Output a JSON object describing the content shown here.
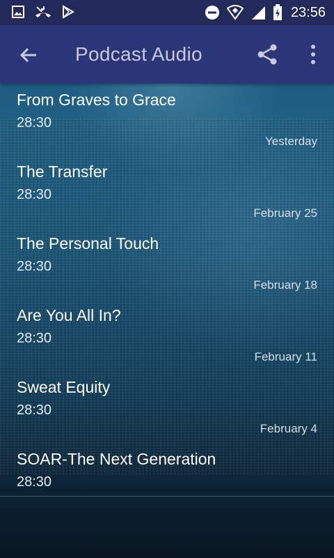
{
  "status_bar": {
    "time": "23:56",
    "left_icons": [
      "image-icon",
      "missed-call-icon",
      "play-store-icon"
    ],
    "right_icons": [
      "do-not-disturb-icon",
      "wifi-icon",
      "signal-icon",
      "battery-charging-icon"
    ]
  },
  "app_bar": {
    "title": "Podcast Audio",
    "back_icon": "arrow-back-icon",
    "share_icon": "share-icon",
    "more_icon": "more-vert-icon"
  },
  "episodes": [
    {
      "title": "From Graves to Grace",
      "duration": "28:30",
      "date": "Yesterday"
    },
    {
      "title": "The Transfer",
      "duration": "28:30",
      "date": "February 25"
    },
    {
      "title": "The Personal Touch",
      "duration": "28:30",
      "date": "February 18"
    },
    {
      "title": "Are You All In?",
      "duration": "28:30",
      "date": "February 11"
    },
    {
      "title": "Sweat Equity",
      "duration": "28:30",
      "date": "February 4"
    },
    {
      "title": "SOAR-The Next Generation",
      "duration": "28:30",
      "date": ""
    }
  ],
  "colors": {
    "status_bar": "#222a5a",
    "app_bar": "#2b3678",
    "title_text": "#c7c9dc"
  }
}
